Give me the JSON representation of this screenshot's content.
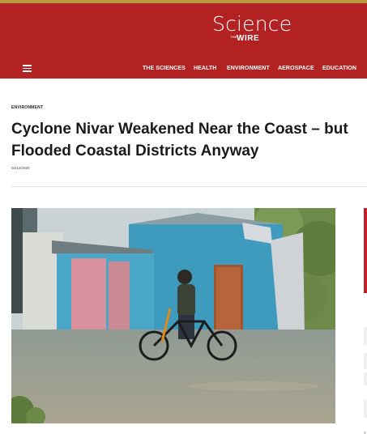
{
  "header": {
    "logo": {
      "title": "Science",
      "prefix": "THE",
      "subtitle": "WIRE"
    },
    "menu_icon": "hamburger-menu-icon",
    "nav": [
      {
        "label": "THE SCIENCES"
      },
      {
        "label": "HEALTH"
      },
      {
        "label": "ENVIRONMENT"
      },
      {
        "label": "AEROSPACE"
      },
      {
        "label": "EDUCATION"
      }
    ]
  },
  "article": {
    "category": "ENVIRONMENT",
    "title": "Cyclone Nivar Weakened Near the Coast – but Flooded Coastal Districts Anyway",
    "date": "02/12/2020"
  },
  "colors": {
    "header_bg": "#b22222",
    "top_strip": "#b89a3e",
    "accent_red": "#c0202a",
    "text_dark": "#1a1a1a"
  }
}
